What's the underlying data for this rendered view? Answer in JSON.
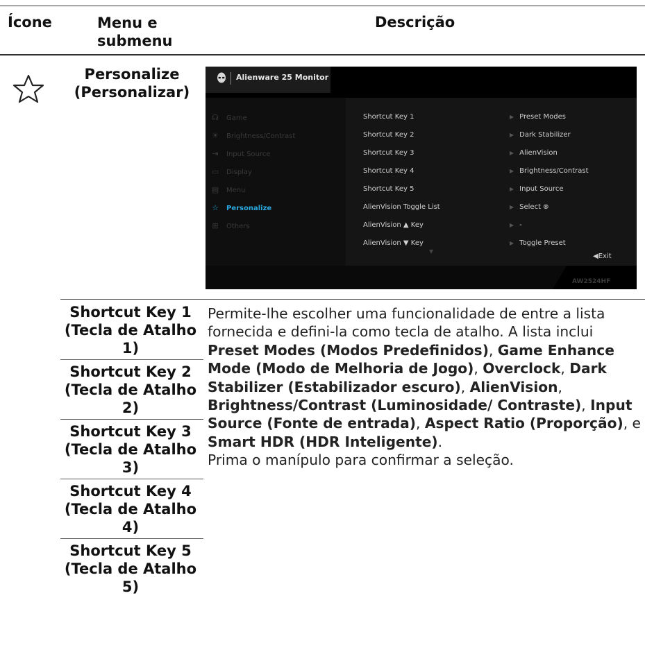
{
  "table": {
    "headers": {
      "icon": "Ícone",
      "menu": "Menu e submenu",
      "description": "Descrição"
    },
    "row": {
      "icon_name": "star-icon",
      "menu_title_line1": "Personalize",
      "menu_title_line2": "(Personalizar)"
    },
    "submenus": [
      {
        "line1": "Shortcut Key 1",
        "line2": "(Tecla de Atalho",
        "line3": "1)"
      },
      {
        "line1": "Shortcut Key 2",
        "line2": "(Tecla de Atalho",
        "line3": "2)"
      },
      {
        "line1": "Shortcut Key 3",
        "line2": "(Tecla de Atalho",
        "line3": "3)"
      },
      {
        "line1": "Shortcut Key 4",
        "line2": "(Tecla de Atalho",
        "line3": "4)"
      },
      {
        "line1": "Shortcut Key 5",
        "line2": "(Tecla de Atalho",
        "line3": "5)"
      }
    ],
    "description": {
      "p1": "Permite-lhe escolher uma funcionalidade de entre a lista fornecida e defini-la como tecla de atalho. A lista inclui ",
      "b1": "Preset Modes (Modos Predefinidos)",
      "s1": ", ",
      "b2": "Game Enhance Mode (Modo de Melhoria de Jogo)",
      "s2": ", ",
      "b3": "Overclock",
      "s3": ", ",
      "b4": "Dark Stabilizer (Estabilizador escuro)",
      "s4": ", ",
      "b5": "AlienVision",
      "s5": ", ",
      "b6": "Brightness/Contrast (Luminosidade/ Contraste)",
      "s6": ", ",
      "b7": "Input Source (Fonte de entrada)",
      "s7": ", ",
      "b8": "Aspect Ratio (Proporção)",
      "s8": ", e ",
      "b9": "Smart HDR (HDR Inteligente)",
      "s9": ".",
      "p2": "Prima o manípulo para confirmar a seleção."
    }
  },
  "osd": {
    "title": "Alienware 25 Monitor",
    "model": "AW2524HF",
    "exit_label": "◀Exit",
    "left_menu": [
      {
        "icon": "gamepad-icon",
        "glyph": "☊",
        "label": "Game"
      },
      {
        "icon": "brightness-icon",
        "glyph": "☀",
        "label": "Brightness/Contrast"
      },
      {
        "icon": "input-source-icon",
        "glyph": "⇥",
        "label": "Input Source"
      },
      {
        "icon": "display-icon",
        "glyph": "▭",
        "label": "Display"
      },
      {
        "icon": "menu-icon",
        "glyph": "▤",
        "label": "Menu"
      },
      {
        "icon": "star-icon",
        "glyph": "☆",
        "label": "Personalize",
        "active": true
      },
      {
        "icon": "others-icon",
        "glyph": "⊞",
        "label": "Others"
      }
    ],
    "settings": [
      {
        "key": "Shortcut Key 1",
        "value": "Preset Modes"
      },
      {
        "key": "Shortcut Key 2",
        "value": "Dark Stabilizer"
      },
      {
        "key": "Shortcut Key 3",
        "value": "AlienVision"
      },
      {
        "key": "Shortcut Key 4",
        "value": "Brightness/Contrast"
      },
      {
        "key": "Shortcut Key 5",
        "value": "Input Source"
      },
      {
        "key": "AlienVision Toggle List",
        "value": "Select ⊗"
      },
      {
        "key": "AlienVision ▲ Key",
        "value": "-"
      },
      {
        "key": "AlienVision ▼ Key",
        "value": "Toggle Preset"
      }
    ],
    "accent_color": "#2aa9e0"
  }
}
